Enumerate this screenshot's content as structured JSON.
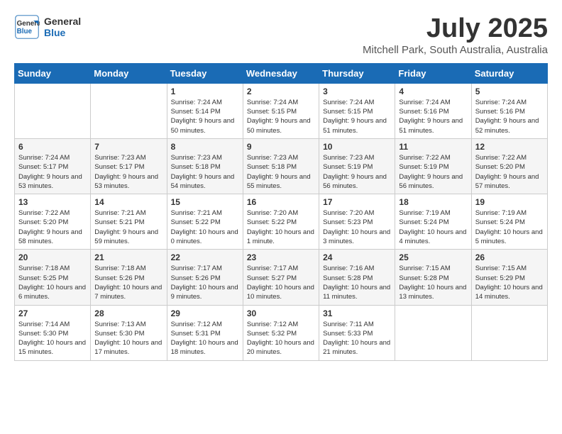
{
  "logo": {
    "line1": "General",
    "line2": "Blue"
  },
  "title": "July 2025",
  "location": "Mitchell Park, South Australia, Australia",
  "days_of_week": [
    "Sunday",
    "Monday",
    "Tuesday",
    "Wednesday",
    "Thursday",
    "Friday",
    "Saturday"
  ],
  "weeks": [
    [
      {
        "day": "",
        "info": ""
      },
      {
        "day": "",
        "info": ""
      },
      {
        "day": "1",
        "info": "Sunrise: 7:24 AM\nSunset: 5:14 PM\nDaylight: 9 hours and 50 minutes."
      },
      {
        "day": "2",
        "info": "Sunrise: 7:24 AM\nSunset: 5:15 PM\nDaylight: 9 hours and 50 minutes."
      },
      {
        "day": "3",
        "info": "Sunrise: 7:24 AM\nSunset: 5:15 PM\nDaylight: 9 hours and 51 minutes."
      },
      {
        "day": "4",
        "info": "Sunrise: 7:24 AM\nSunset: 5:16 PM\nDaylight: 9 hours and 51 minutes."
      },
      {
        "day": "5",
        "info": "Sunrise: 7:24 AM\nSunset: 5:16 PM\nDaylight: 9 hours and 52 minutes."
      }
    ],
    [
      {
        "day": "6",
        "info": "Sunrise: 7:24 AM\nSunset: 5:17 PM\nDaylight: 9 hours and 53 minutes."
      },
      {
        "day": "7",
        "info": "Sunrise: 7:23 AM\nSunset: 5:17 PM\nDaylight: 9 hours and 53 minutes."
      },
      {
        "day": "8",
        "info": "Sunrise: 7:23 AM\nSunset: 5:18 PM\nDaylight: 9 hours and 54 minutes."
      },
      {
        "day": "9",
        "info": "Sunrise: 7:23 AM\nSunset: 5:18 PM\nDaylight: 9 hours and 55 minutes."
      },
      {
        "day": "10",
        "info": "Sunrise: 7:23 AM\nSunset: 5:19 PM\nDaylight: 9 hours and 56 minutes."
      },
      {
        "day": "11",
        "info": "Sunrise: 7:22 AM\nSunset: 5:19 PM\nDaylight: 9 hours and 56 minutes."
      },
      {
        "day": "12",
        "info": "Sunrise: 7:22 AM\nSunset: 5:20 PM\nDaylight: 9 hours and 57 minutes."
      }
    ],
    [
      {
        "day": "13",
        "info": "Sunrise: 7:22 AM\nSunset: 5:20 PM\nDaylight: 9 hours and 58 minutes."
      },
      {
        "day": "14",
        "info": "Sunrise: 7:21 AM\nSunset: 5:21 PM\nDaylight: 9 hours and 59 minutes."
      },
      {
        "day": "15",
        "info": "Sunrise: 7:21 AM\nSunset: 5:22 PM\nDaylight: 10 hours and 0 minutes."
      },
      {
        "day": "16",
        "info": "Sunrise: 7:20 AM\nSunset: 5:22 PM\nDaylight: 10 hours and 1 minute."
      },
      {
        "day": "17",
        "info": "Sunrise: 7:20 AM\nSunset: 5:23 PM\nDaylight: 10 hours and 3 minutes."
      },
      {
        "day": "18",
        "info": "Sunrise: 7:19 AM\nSunset: 5:24 PM\nDaylight: 10 hours and 4 minutes."
      },
      {
        "day": "19",
        "info": "Sunrise: 7:19 AM\nSunset: 5:24 PM\nDaylight: 10 hours and 5 minutes."
      }
    ],
    [
      {
        "day": "20",
        "info": "Sunrise: 7:18 AM\nSunset: 5:25 PM\nDaylight: 10 hours and 6 minutes."
      },
      {
        "day": "21",
        "info": "Sunrise: 7:18 AM\nSunset: 5:26 PM\nDaylight: 10 hours and 7 minutes."
      },
      {
        "day": "22",
        "info": "Sunrise: 7:17 AM\nSunset: 5:26 PM\nDaylight: 10 hours and 9 minutes."
      },
      {
        "day": "23",
        "info": "Sunrise: 7:17 AM\nSunset: 5:27 PM\nDaylight: 10 hours and 10 minutes."
      },
      {
        "day": "24",
        "info": "Sunrise: 7:16 AM\nSunset: 5:28 PM\nDaylight: 10 hours and 11 minutes."
      },
      {
        "day": "25",
        "info": "Sunrise: 7:15 AM\nSunset: 5:28 PM\nDaylight: 10 hours and 13 minutes."
      },
      {
        "day": "26",
        "info": "Sunrise: 7:15 AM\nSunset: 5:29 PM\nDaylight: 10 hours and 14 minutes."
      }
    ],
    [
      {
        "day": "27",
        "info": "Sunrise: 7:14 AM\nSunset: 5:30 PM\nDaylight: 10 hours and 15 minutes."
      },
      {
        "day": "28",
        "info": "Sunrise: 7:13 AM\nSunset: 5:30 PM\nDaylight: 10 hours and 17 minutes."
      },
      {
        "day": "29",
        "info": "Sunrise: 7:12 AM\nSunset: 5:31 PM\nDaylight: 10 hours and 18 minutes."
      },
      {
        "day": "30",
        "info": "Sunrise: 7:12 AM\nSunset: 5:32 PM\nDaylight: 10 hours and 20 minutes."
      },
      {
        "day": "31",
        "info": "Sunrise: 7:11 AM\nSunset: 5:33 PM\nDaylight: 10 hours and 21 minutes."
      },
      {
        "day": "",
        "info": ""
      },
      {
        "day": "",
        "info": ""
      }
    ]
  ]
}
